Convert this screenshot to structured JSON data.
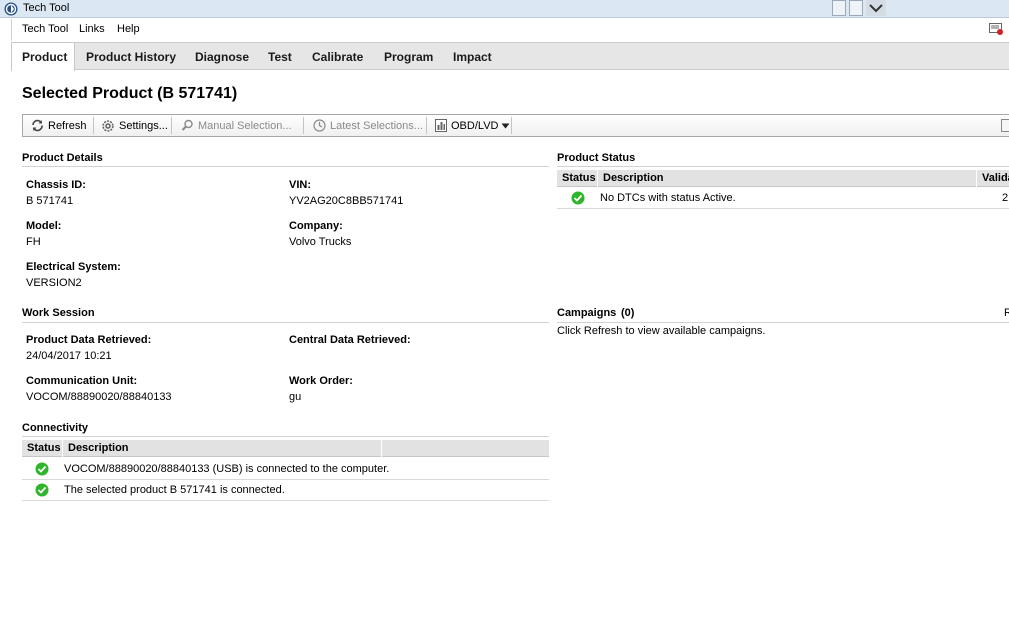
{
  "window": {
    "title": "Tech Tool"
  },
  "menu": {
    "items": [
      "Tech Tool",
      "Links",
      "Help"
    ]
  },
  "tabs": [
    "Product",
    "Product History",
    "Diagnose",
    "Test",
    "Calibrate",
    "Program",
    "Impact"
  ],
  "page": {
    "title": "Selected Product (B 571741)"
  },
  "toolbar": {
    "refresh": "Refresh",
    "settings": "Settings...",
    "manual_selection": "Manual Selection...",
    "latest_selections": "Latest Selections...",
    "obd": "OBD/LVD"
  },
  "product_details": {
    "heading": "Product Details",
    "chassis_label": "Chassis ID:",
    "chassis_value": "B 571741",
    "vin_label": "VIN:",
    "vin_value": "YV2AG20C8BB571741",
    "model_label": "Model:",
    "model_value": "FH",
    "company_label": "Company:",
    "company_value": "Volvo Trucks",
    "electrical_label": "Electrical System:",
    "electrical_value": "VERSION2"
  },
  "product_status": {
    "heading": "Product Status",
    "columns": [
      "Status",
      "Description",
      "Valida"
    ],
    "rows": [
      {
        "status": "ok",
        "description": "No DTCs with status Active.",
        "validity": "2"
      }
    ]
  },
  "work_session": {
    "heading": "Work Session",
    "retrieved_label": "Product Data Retrieved:",
    "retrieved_value": "24/04/2017 10:21",
    "central_label": "Central Data Retrieved:",
    "comm_label": "Communication Unit:",
    "comm_value": "VOCOM/88890020/88840133",
    "order_label": "Work Order:",
    "order_value": "gu"
  },
  "campaigns": {
    "heading": "Campaigns",
    "count": "(0)",
    "trailing": "R",
    "message": "Click Refresh to view available campaigns."
  },
  "connectivity": {
    "heading": "Connectivity",
    "columns": [
      "Status",
      "Description"
    ],
    "rows": [
      {
        "status": "ok",
        "description": "VOCOM/88890020/88840133 (USB) is connected to the computer."
      },
      {
        "status": "ok",
        "description": "The selected product B 571741 is connected."
      }
    ]
  },
  "colors": {
    "ok_green": "#2fb52b",
    "header_gray": "#e2e2e2",
    "titlebar": "#dbe7f3"
  },
  "icons": [
    "app-icon",
    "refresh-icon",
    "gear-icon",
    "search-icon",
    "clock-icon",
    "obd-icon",
    "dropdown-arrow-icon",
    "help-icon",
    "check-icon"
  ]
}
